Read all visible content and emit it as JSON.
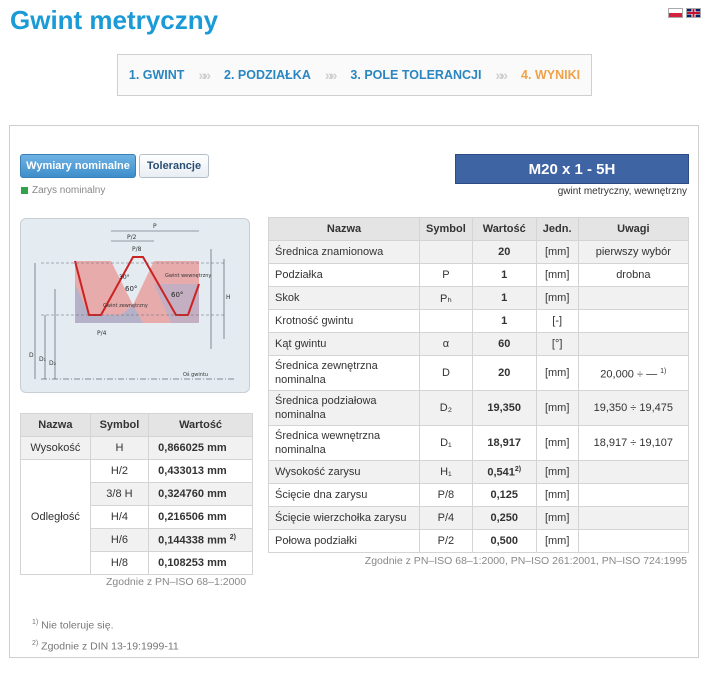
{
  "page": {
    "title": "Gwint metryczny"
  },
  "steps": [
    {
      "label": "1. GWINT",
      "active": false
    },
    {
      "label": "2. PODZIAŁKA",
      "active": false
    },
    {
      "label": "3. POLE TOLERANCJI",
      "active": false
    },
    {
      "label": "4. WYNIKI",
      "active": true
    }
  ],
  "step_separator": "»»",
  "tabs": {
    "nominal": "Wymiary nominalne",
    "tolerances": "Tolerancje"
  },
  "legend": {
    "label": "Zarys nominalny",
    "color": "#2fa24a"
  },
  "result": {
    "designation": "M20 x 1 - 5H",
    "subtitle": "gwint metryczny, wewnętrzny"
  },
  "diagram": {
    "labels": {
      "p": "P",
      "p2": "P/2",
      "p4": "P/4",
      "p8": "P/8",
      "h": "H",
      "d": "D",
      "d1": "D₁",
      "d2": "D₂",
      "angle": "60°",
      "angle30": "30°",
      "nut": "Gwint wewnętrzny",
      "bolt": "Gwint zewnętrzny",
      "axis": "Oś gwintu"
    },
    "colors": {
      "nut": "#e8a0a0",
      "bolt": "#9fb4d6",
      "outline": "#cc2222"
    }
  },
  "left_table": {
    "headers": [
      "Nazwa",
      "Symbol",
      "Wartość"
    ],
    "rows": [
      {
        "name": "Wysokość",
        "symbol": "H",
        "value": "0,866025 mm"
      },
      {
        "name": "Odległość",
        "symbol": "H/2",
        "value": "0,433013 mm"
      },
      {
        "name": "",
        "symbol": "3/8 H",
        "value": "0,324760 mm"
      },
      {
        "name": "",
        "symbol": "H/4",
        "value": "0,216506 mm"
      },
      {
        "name": "",
        "symbol": "H/6",
        "value": "0,144338 mm",
        "sup": "2)"
      },
      {
        "name": "",
        "symbol": "H/8",
        "value": "0,108253 mm"
      }
    ],
    "note": "Zgodnie z PN–ISO 68–1:2000"
  },
  "main_table": {
    "headers": [
      "Nazwa",
      "Symbol",
      "Wartość",
      "Jedn.",
      "Uwagi"
    ],
    "rows": [
      {
        "name": "Średnica znamionowa",
        "symbol": "",
        "value": "20",
        "unit": "[mm]",
        "note": "pierwszy wybór"
      },
      {
        "name": "Podziałka",
        "symbol": "P",
        "value": "1",
        "unit": "[mm]",
        "note": "drobna"
      },
      {
        "name": "Skok",
        "symbol": "Pₕ",
        "value": "1",
        "unit": "[mm]",
        "note": ""
      },
      {
        "name": "Krotność gwintu",
        "symbol": "",
        "value": "1",
        "unit": "[-]",
        "note": ""
      },
      {
        "name": "Kąt gwintu",
        "symbol": "α",
        "value": "60",
        "unit": "[°]",
        "note": ""
      },
      {
        "name": "Średnica zewnętrzna nominalna",
        "symbol": "D",
        "value": "20",
        "unit": "[mm]",
        "note": "20,000 ÷ —",
        "note_sup": "1)"
      },
      {
        "name": "Średnica podziałowa nominalna",
        "symbol": "D₂",
        "value": "19,350",
        "unit": "[mm]",
        "note": "19,350 ÷ 19,475"
      },
      {
        "name": "Średnica wewnętrzna nominalna",
        "symbol": "D₁",
        "value": "18,917",
        "unit": "[mm]",
        "note": "18,917 ÷ 19,107"
      },
      {
        "name": "Wysokość zarysu",
        "symbol": "H₁",
        "value": "0,541",
        "value_sup": "2)",
        "unit": "[mm]",
        "note": ""
      },
      {
        "name": "Ścięcie dna zarysu",
        "symbol": "P/8",
        "value": "0,125",
        "unit": "[mm]",
        "note": ""
      },
      {
        "name": "Ścięcie wierzchołka zarysu",
        "symbol": "P/4",
        "value": "0,250",
        "unit": "[mm]",
        "note": ""
      },
      {
        "name": "Połowa podziałki",
        "symbol": "P/2",
        "value": "0,500",
        "unit": "[mm]",
        "note": ""
      }
    ],
    "note": "Zgodnie z PN–ISO 68–1:2000, PN–ISO 261:2001, PN–ISO 724:1995"
  },
  "footnotes": [
    {
      "mark": "1)",
      "text": "Nie toleruje się."
    },
    {
      "mark": "2)",
      "text": "Zgodnie z DIN 13-19:1999-11"
    }
  ]
}
